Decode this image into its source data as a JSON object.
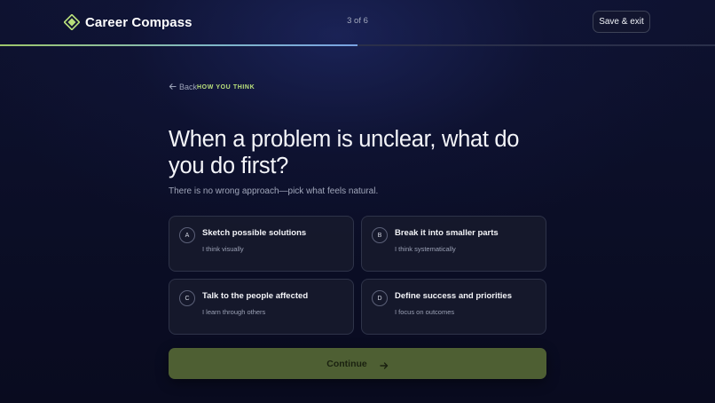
{
  "header": {
    "brand_name": "Career Compass",
    "step_indicator": "3 of 6",
    "save_exit_label": "Save & exit",
    "progress_fraction": 0.5
  },
  "nav": {
    "back_label": "Back",
    "back_icon": "arrow-left-icon",
    "section_label": "HOW YOU THINK"
  },
  "question": {
    "title": "When a problem is unclear, what do you do first?",
    "subtitle": "There is no wrong approach—pick what feels natural."
  },
  "options": [
    {
      "letter": "A",
      "title": "Sketch possible solutions",
      "description": "I think visually"
    },
    {
      "letter": "B",
      "title": "Break it into smaller parts",
      "description": "I think systematically"
    },
    {
      "letter": "C",
      "title": "Talk to the people affected",
      "description": "I learn through others"
    },
    {
      "letter": "D",
      "title": "Define success and priorities",
      "description": "I focus on outcomes"
    }
  ],
  "continue": {
    "label": "Continue",
    "icon": "arrow-right-icon"
  },
  "colors": {
    "accent": "#b9e07b",
    "continue_bg": "#4e5f33",
    "background": "#0b0e26"
  }
}
